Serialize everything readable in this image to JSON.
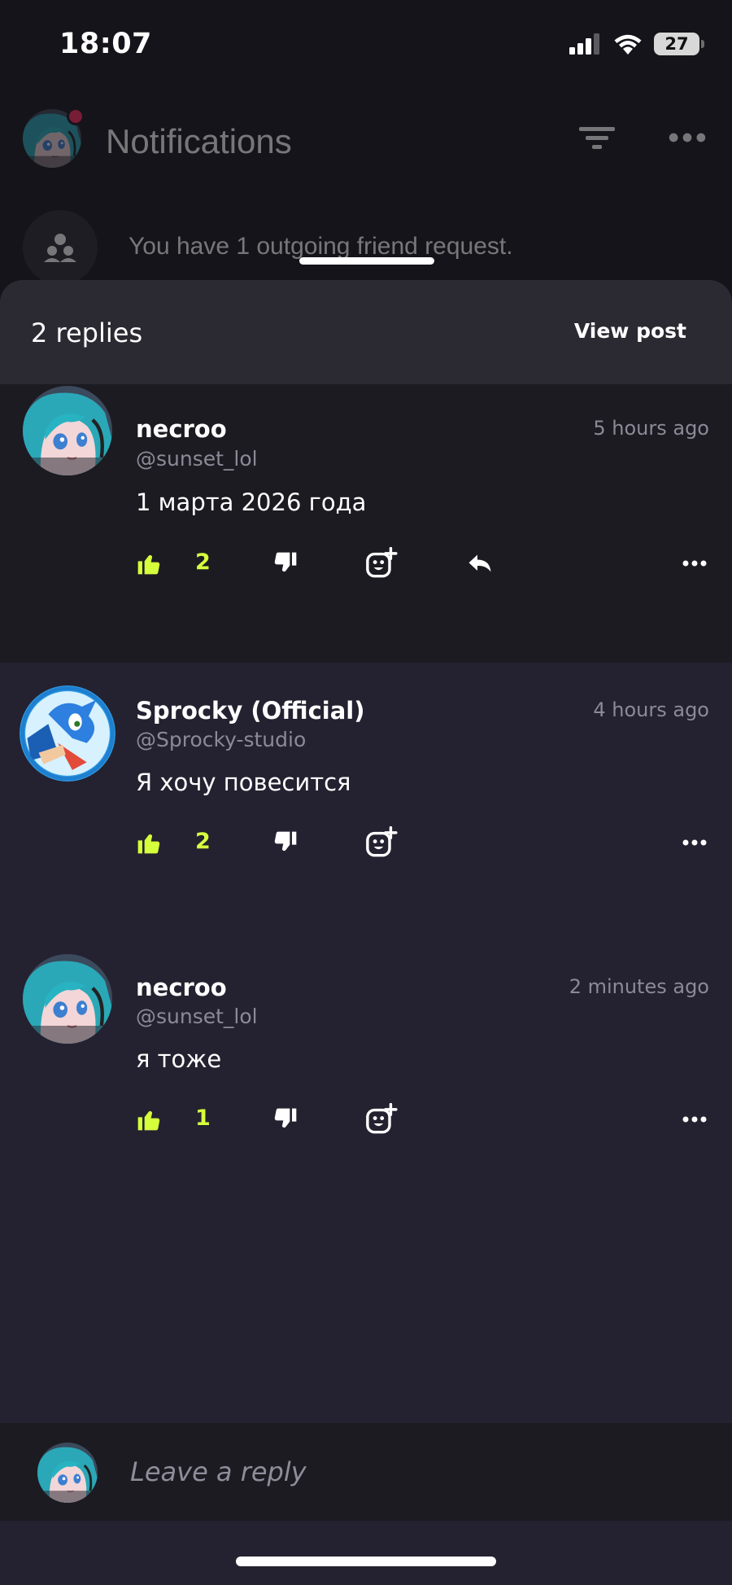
{
  "status_bar": {
    "time": "18:07",
    "battery": "27"
  },
  "background": {
    "title": "Notifications",
    "friend_request_text": "You have 1 outgoing friend request."
  },
  "sheet": {
    "replies_count": "2 replies",
    "view_post_label": "View post"
  },
  "comments": [
    {
      "author": "necroo",
      "handle": "@sunset_lol",
      "time": "5 hours ago",
      "text": "1 марта 2026 года",
      "likes": "2",
      "avatar": "anime-avatar"
    },
    {
      "author": "Sprocky (Official)",
      "handle": "@Sprocky-studio",
      "time": "4 hours ago",
      "text": "Я хочу повесится",
      "likes": "2",
      "avatar": "blue-hedgehog-avatar"
    },
    {
      "author": "necroo",
      "handle": "@sunset_lol",
      "time": "2 minutes ago",
      "text": "я тоже",
      "likes": "1",
      "avatar": "anime-avatar"
    }
  ],
  "reply_bar": {
    "placeholder": "Leave a reply"
  },
  "colors": {
    "accent_like": "#d6ff3c",
    "sheet_bg": "#242230",
    "highlight_row_bg": "#1c1b22",
    "notification_dot": "#ff2b5a"
  },
  "icons": {
    "like": "thumbs-up-icon",
    "dislike": "thumbs-down-icon",
    "reaction": "add-reaction-icon",
    "reply": "reply-arrow-icon",
    "more": "more-dots-icon"
  }
}
